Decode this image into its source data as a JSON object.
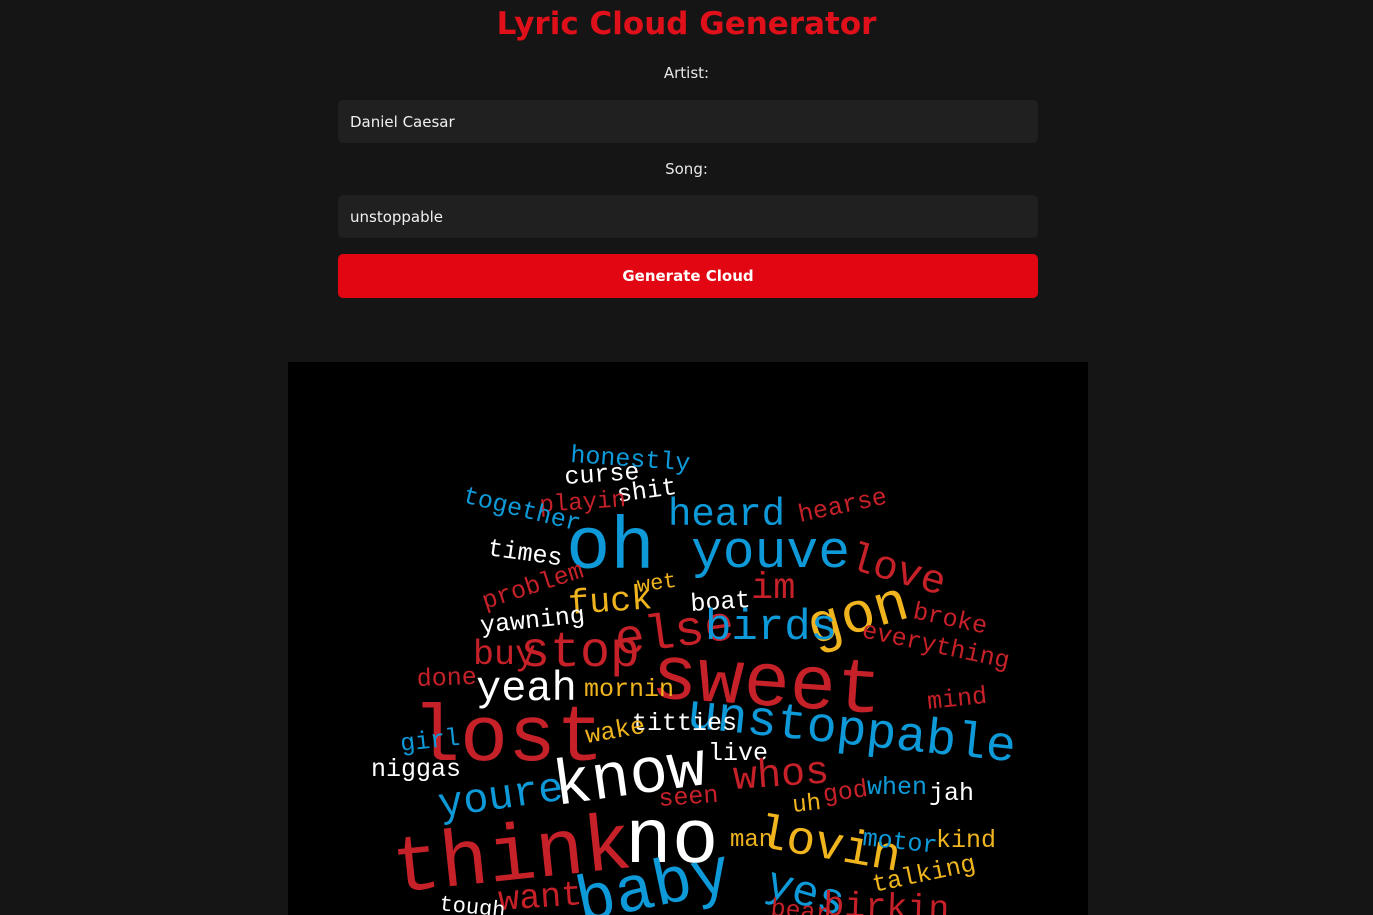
{
  "app": {
    "title": "Lyric Cloud Generator"
  },
  "form": {
    "artist_label": "Artist:",
    "artist_value": "Daniel Caesar",
    "song_label": "Song:",
    "song_value": "unstoppable",
    "generate_label": "Generate Cloud"
  },
  "colors": {
    "accent": "#e20613",
    "background": "#151515",
    "input_background": "#202020",
    "cloud_background": "#000000",
    "word_red": "#c62128",
    "word_blue": "#0e9ad8",
    "word_yellow": "#f0b51e",
    "word_white": "#ffffff"
  },
  "cloud": {
    "words": [
      {
        "text": "honestly",
        "color": "blue"
      },
      {
        "text": "curse",
        "color": "white"
      },
      {
        "text": "shit",
        "color": "white"
      },
      {
        "text": "playin",
        "color": "red"
      },
      {
        "text": "together",
        "color": "blue"
      },
      {
        "text": "oh",
        "color": "blue"
      },
      {
        "text": "heard",
        "color": "blue"
      },
      {
        "text": "hearse",
        "color": "red"
      },
      {
        "text": "times",
        "color": "white"
      },
      {
        "text": "youve",
        "color": "blue"
      },
      {
        "text": "love",
        "color": "red"
      },
      {
        "text": "problem",
        "color": "red"
      },
      {
        "text": "wet",
        "color": "yellow"
      },
      {
        "text": "im",
        "color": "red"
      },
      {
        "text": "boat",
        "color": "white"
      },
      {
        "text": "gon",
        "color": "yellow"
      },
      {
        "text": "fuck",
        "color": "yellow"
      },
      {
        "text": "yawning",
        "color": "white"
      },
      {
        "text": "else",
        "color": "red"
      },
      {
        "text": "birds",
        "color": "blue"
      },
      {
        "text": "broke",
        "color": "red"
      },
      {
        "text": "everything",
        "color": "red"
      },
      {
        "text": "buy",
        "color": "red"
      },
      {
        "text": "stop",
        "color": "red"
      },
      {
        "text": "sweet",
        "color": "red"
      },
      {
        "text": "done",
        "color": "red"
      },
      {
        "text": "yeah",
        "color": "white"
      },
      {
        "text": "mornin",
        "color": "yellow"
      },
      {
        "text": "mind",
        "color": "red"
      },
      {
        "text": "lost",
        "color": "red"
      },
      {
        "text": "unstoppable",
        "color": "blue"
      },
      {
        "text": "titties",
        "color": "white"
      },
      {
        "text": "wake",
        "color": "yellow"
      },
      {
        "text": "girl",
        "color": "blue"
      },
      {
        "text": "live",
        "color": "white"
      },
      {
        "text": "niggas",
        "color": "white"
      },
      {
        "text": "know",
        "color": "white"
      },
      {
        "text": "whos",
        "color": "red"
      },
      {
        "text": "youre",
        "color": "blue"
      },
      {
        "text": "seen",
        "color": "red"
      },
      {
        "text": "god",
        "color": "red"
      },
      {
        "text": "when",
        "color": "blue"
      },
      {
        "text": "jah",
        "color": "white"
      },
      {
        "text": "uh",
        "color": "yellow"
      },
      {
        "text": "think",
        "color": "red"
      },
      {
        "text": "no",
        "color": "white"
      },
      {
        "text": "man",
        "color": "yellow"
      },
      {
        "text": "lovin",
        "color": "yellow"
      },
      {
        "text": "motor",
        "color": "blue"
      },
      {
        "text": "kind",
        "color": "yellow"
      },
      {
        "text": "talking",
        "color": "yellow"
      },
      {
        "text": "yes",
        "color": "blue"
      },
      {
        "text": "baby",
        "color": "blue"
      },
      {
        "text": "want",
        "color": "red"
      },
      {
        "text": "tough",
        "color": "white"
      },
      {
        "text": "bear",
        "color": "red"
      },
      {
        "text": "birkin",
        "color": "red"
      }
    ]
  }
}
